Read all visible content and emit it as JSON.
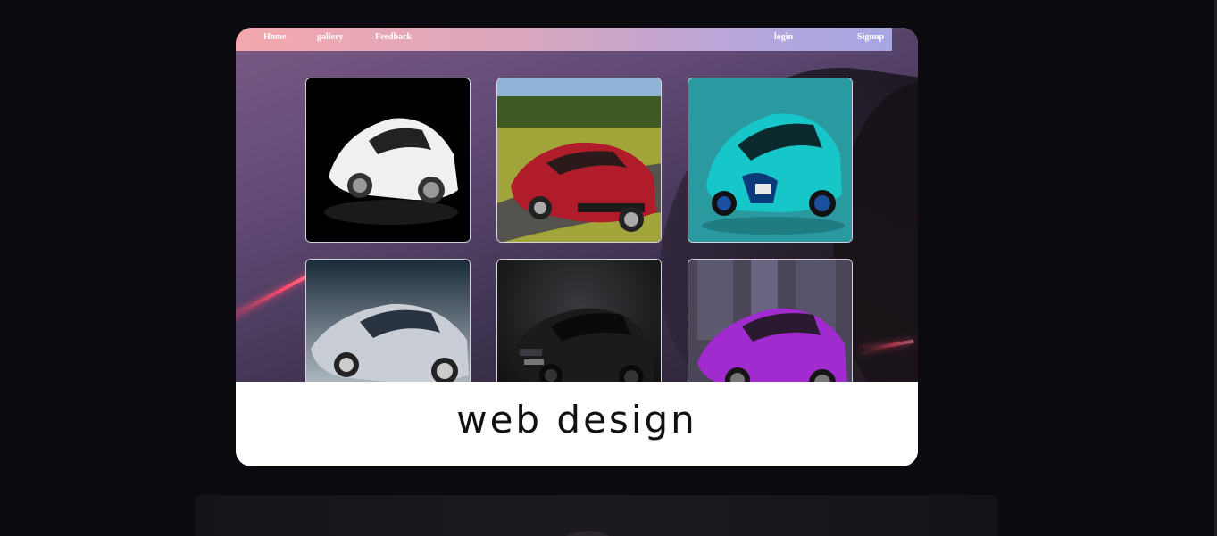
{
  "nav": {
    "home": "Home",
    "gallery": "gallery",
    "feedback": "Feedback",
    "login": "login",
    "signup": "Signup"
  },
  "gallery": {
    "items": [
      {
        "icon": "white-sports-car-image",
        "bg": "#000000",
        "body": "#f2f2f2"
      },
      {
        "icon": "red-muscle-car-image",
        "bg": "#7a8a3a",
        "body": "#b01c2a"
      },
      {
        "icon": "teal-hypercar-image",
        "bg": "#2a9aa0",
        "body": "#18c6c8"
      },
      {
        "icon": "silver-coupe-image",
        "bg": "#aeb8c2",
        "body": "#c8ced6"
      },
      {
        "icon": "black-sedan-image",
        "bg": "#101012",
        "body": "#222226"
      },
      {
        "icon": "purple-supercar-image",
        "bg": "#4a4658",
        "body": "#a22bd0"
      }
    ]
  },
  "caption": {
    "title": "web design"
  },
  "colors": {
    "background": "#0b0a0f",
    "nav_gradient_start": "#f4a7ad",
    "nav_gradient_end": "#a7a6e3",
    "card": "#ffffff"
  }
}
